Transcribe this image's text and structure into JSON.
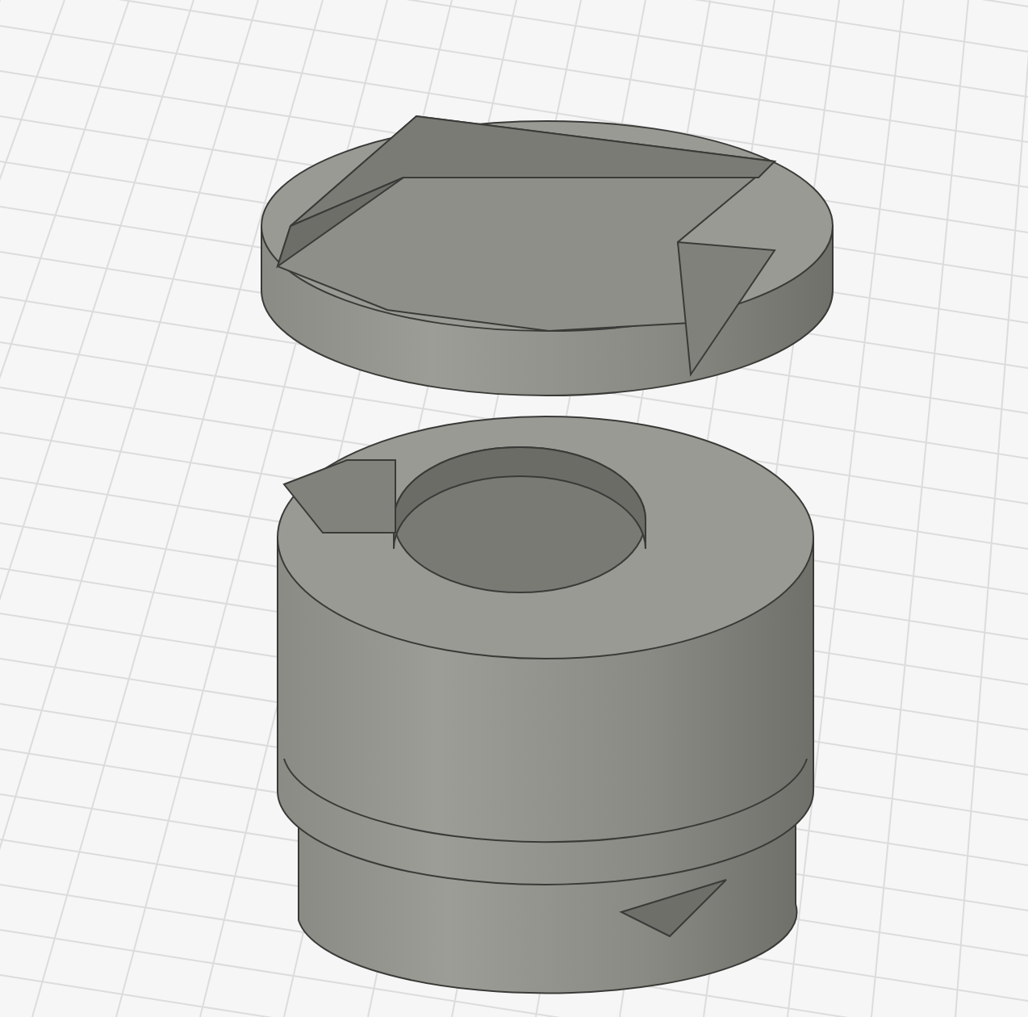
{
  "viewport": {
    "parts": [
      {
        "kind": "lid"
      },
      {
        "kind": "sleeve"
      }
    ]
  }
}
